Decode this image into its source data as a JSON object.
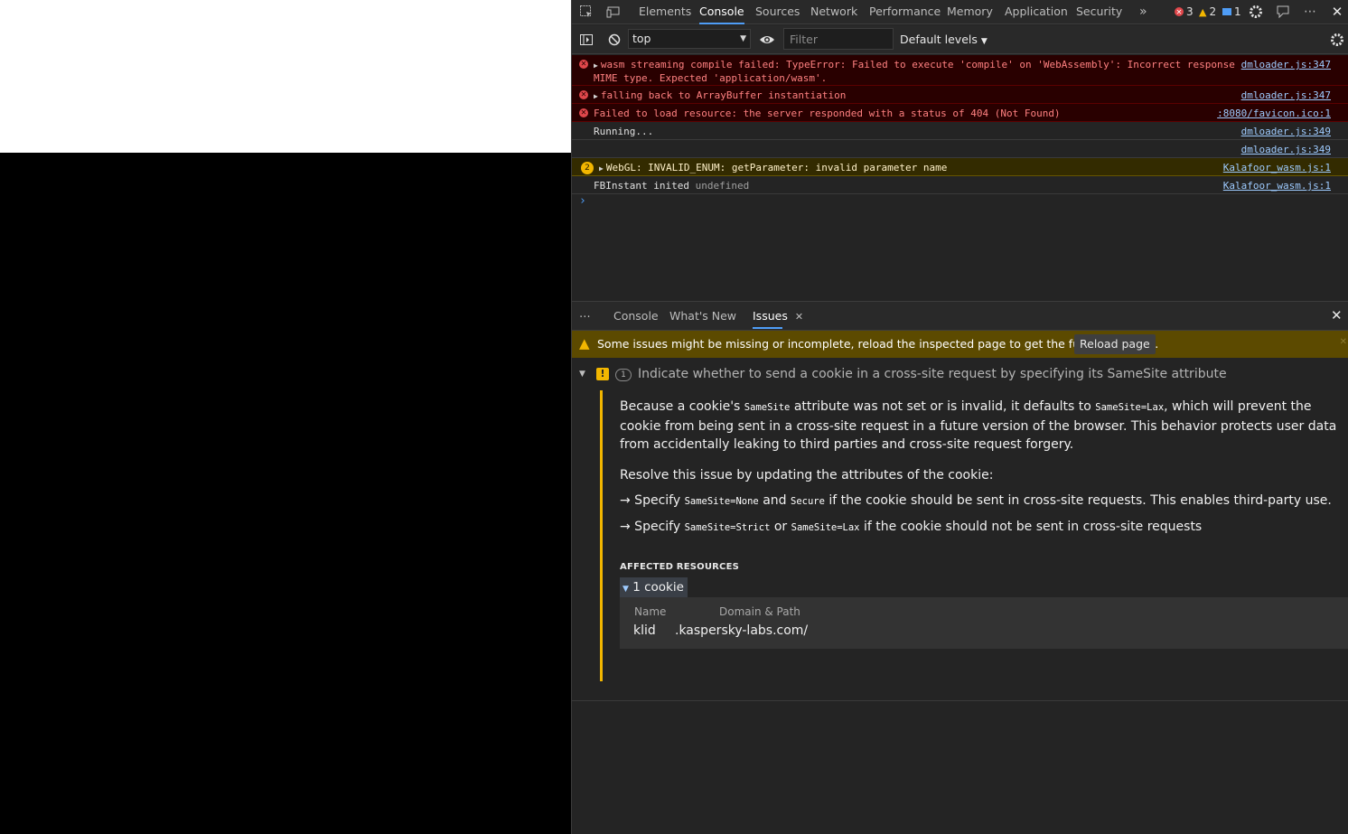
{
  "devtools": {
    "tabs": [
      "Elements",
      "Console",
      "Sources",
      "Network",
      "Performance",
      "Memory",
      "Application",
      "Security"
    ],
    "active_tab": "Console",
    "more_tabs": "»",
    "counts": {
      "errors": "3",
      "warnings": "2",
      "messages": "1"
    }
  },
  "toolbar": {
    "context": "top",
    "filter_placeholder": "Filter",
    "levels": "Default levels"
  },
  "console": {
    "messages": [
      {
        "level": "error",
        "text": "wasm streaming compile failed: TypeError: Failed to execute 'compile' on 'WebAssembly': Incorrect response MIME type. Expected 'application/wasm'.",
        "source": "dmloader.js:347"
      },
      {
        "level": "error",
        "text": "falling back to ArrayBuffer instantiation",
        "source": "dmloader.js:347"
      },
      {
        "level": "error",
        "text": "Failed to load resource: the server responded with a status of 404 (Not Found)",
        "source": ":8080/favicon.ico:1"
      },
      {
        "level": "log",
        "text": "Running...",
        "source": "dmloader.js:349"
      },
      {
        "level": "log",
        "text": "",
        "source": "dmloader.js:349"
      },
      {
        "level": "warning",
        "count": "2",
        "text": "WebGL: INVALID_ENUM: getParameter: invalid parameter name",
        "source": "Kalafoor_wasm.js:1"
      },
      {
        "level": "log",
        "text": "FBInstant inited",
        "extra": "undefined",
        "source": "Kalafoor_wasm.js:1"
      }
    ],
    "prompt": "›"
  },
  "drawer": {
    "tabs": [
      "Console",
      "What's New",
      "Issues"
    ],
    "active_tab": "Issues",
    "info": "Some issues might be missing or incomplete, reload the inspected page to get the full information.",
    "reload_button": "Reload page",
    "issue": {
      "count": "1",
      "title": "Indicate whether to send a cookie in a cross-site request by specifying its SameSite attribute",
      "p1_a": "Because a cookie's ",
      "p1_code1": "SameSite",
      "p1_b": " attribute was not set or is invalid, it defaults to ",
      "p1_code2": "SameSite=Lax",
      "p1_c": ", which will prevent the cookie from being sent in a cross-site request in a future version of the browser. This behavior protects user data from accidentally leaking to third parties and cross-site request forgery.",
      "resolve": "Resolve this issue by updating the attributes of the cookie:",
      "b1_a": "→ Specify ",
      "b1_code1": "SameSite=None",
      "b1_b": " and ",
      "b1_code2": "Secure",
      "b1_c": " if the cookie should be sent in cross-site requests. This enables third-party use.",
      "b2_a": "→ Specify ",
      "b2_code1": "SameSite=Strict",
      "b2_b": " or ",
      "b2_code2": "SameSite=Lax",
      "b2_c": " if the cookie should not be sent in cross-site requests",
      "affected_heading": "AFFECTED RESOURCES",
      "cookie_toggle": "1 cookie",
      "col_name": "Name",
      "col_domain": "Domain & Path",
      "cookie_name": "klid",
      "cookie_domain": ".kaspersky-labs.com/"
    }
  },
  "colors": {
    "accent": "#4f9df6",
    "error_bg": "#290000",
    "warning_bg": "#332b00",
    "info_bar": "#5c4a00",
    "issue_border": "#f2b600"
  }
}
